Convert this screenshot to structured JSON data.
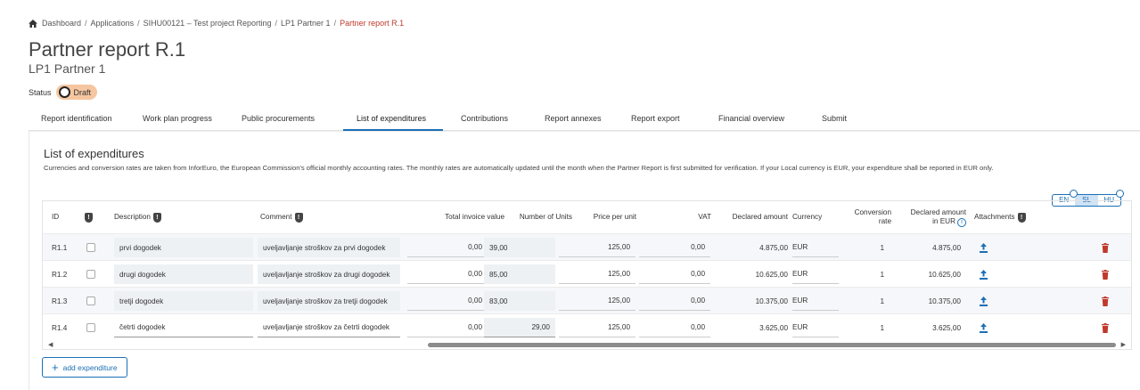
{
  "breadcrumb": {
    "items": [
      "Dashboard",
      "Applications",
      "SIHU00121 – Test project Reporting",
      "LP1 Partner 1"
    ],
    "current": "Partner report R.1",
    "separator": "/"
  },
  "header": {
    "title": "Partner report R.1",
    "subtitle": "LP1 Partner 1",
    "status_label": "Status",
    "status_value": "Draft"
  },
  "tabs": [
    {
      "label": "Report identification",
      "active": false
    },
    {
      "label": "Work plan progress",
      "active": false
    },
    {
      "label": "Public procurements",
      "active": false
    },
    {
      "label": "List of expenditures",
      "active": true
    },
    {
      "label": "Contributions",
      "active": false
    },
    {
      "label": "Report annexes",
      "active": false
    },
    {
      "label": "Report export",
      "active": false
    },
    {
      "label": "Financial overview",
      "active": false
    },
    {
      "label": "Submit",
      "active": false
    }
  ],
  "section": {
    "title": "List of expenditures",
    "description": "Currencies and conversion rates are taken from InforEuro, the European Commission's official monthly accounting rates. The monthly rates are automatically updated until the month when the Partner Report is first submitted for verification. If your Local currency is EUR, your expenditure shall be reported in EUR only."
  },
  "languages": {
    "options": [
      "EN",
      "SL",
      "HU"
    ],
    "selected": "SL"
  },
  "table": {
    "columns": {
      "id": "ID",
      "description": "Description",
      "comment": "Comment",
      "total_invoice": "Total invoice value",
      "units": "Number of Units",
      "price": "Price per unit",
      "vat": "VAT",
      "declared": "Declared amount",
      "currency": "Currency",
      "conversion_1": "Conversion",
      "conversion_2": "rate",
      "declared_eur_1": "Declared amount",
      "declared_eur_2": "in EUR",
      "attachments": "Attachments"
    },
    "rows": [
      {
        "id": "R1.1",
        "description": "prvi dogodek",
        "comment": "uveljavljanje stroškov za prvi dogodek",
        "total": "0,00",
        "units": "39,00",
        "price": "125,00",
        "vat": "0,00",
        "declared": "4.875,00",
        "currency": "EUR",
        "rate": "1",
        "declared_eur": "4.875,00"
      },
      {
        "id": "R1.2",
        "description": "drugi dogodek",
        "comment": "uveljavljanje stroškov za drugi dogodek",
        "total": "0,00",
        "units": "85,00",
        "price": "125,00",
        "vat": "0,00",
        "declared": "10.625,00",
        "currency": "EUR",
        "rate": "1",
        "declared_eur": "10.625,00"
      },
      {
        "id": "R1.3",
        "description": "tretji dogodek",
        "comment": "uveljavljanje stroškov za tretji dogodek",
        "total": "0,00",
        "units": "83,00",
        "price": "125,00",
        "vat": "0,00",
        "declared": "10.375,00",
        "currency": "EUR",
        "rate": "1",
        "declared_eur": "10.375,00"
      },
      {
        "id": "R1.4",
        "description": "četrti dogodek",
        "comment": "uveljavljanje stroškov za četrti dogodek",
        "total": "0,00",
        "units": "29,00",
        "price": "125,00",
        "vat": "0,00",
        "declared": "3.625,00",
        "currency": "EUR",
        "rate": "1",
        "declared_eur": "3.625,00"
      }
    ]
  },
  "actions": {
    "add_expenditure": "add expenditure"
  },
  "colors": {
    "accent": "#1b6fb5",
    "current_crumb": "#c0392b",
    "draft_badge": "#f5c6a0",
    "delete": "#c0392b"
  }
}
